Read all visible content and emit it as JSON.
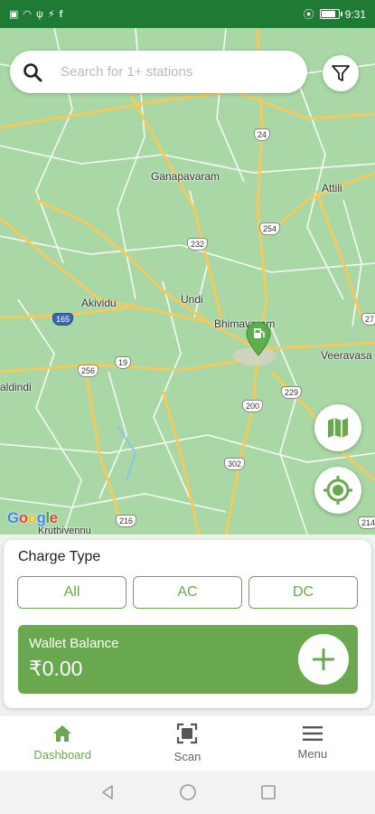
{
  "status_bar": {
    "time": "9:31",
    "battery_level": 0.75,
    "left_icons": [
      "sim-icon",
      "wifi-icon",
      "usb-icon",
      "charging-icon",
      "facebook-icon"
    ],
    "right_icons": [
      "location-icon",
      "battery-icon"
    ]
  },
  "search": {
    "placeholder": "Search for 1+ stations",
    "value": ""
  },
  "map": {
    "places": [
      "Ganapavaram",
      "Attili",
      "Undi",
      "Akividu",
      "Bhimavaram",
      "Veeravasa",
      "aldindi",
      "Kruthivennu"
    ],
    "route_shields": [
      "24",
      "254",
      "232",
      "165",
      "256",
      "19",
      "229",
      "200",
      "302",
      "216",
      "214",
      "27"
    ],
    "attribution": "Google"
  },
  "charge_type": {
    "title": "Charge Type",
    "options": [
      "All",
      "AC",
      "DC"
    ],
    "selected": "All"
  },
  "wallet": {
    "label": "Wallet Balance",
    "amount": "₹0.00"
  },
  "bottom_nav": {
    "items": [
      {
        "label": "Dashboard",
        "icon": "home-icon",
        "active": true
      },
      {
        "label": "Scan",
        "icon": "scan-icon",
        "active": false
      },
      {
        "label": "Menu",
        "icon": "menu-icon",
        "active": false
      }
    ]
  },
  "colors": {
    "status_bar": "#1f7a33",
    "accent": "#6aa84f",
    "map_bg": "#a9d8a6",
    "road": "#f4c95d"
  }
}
